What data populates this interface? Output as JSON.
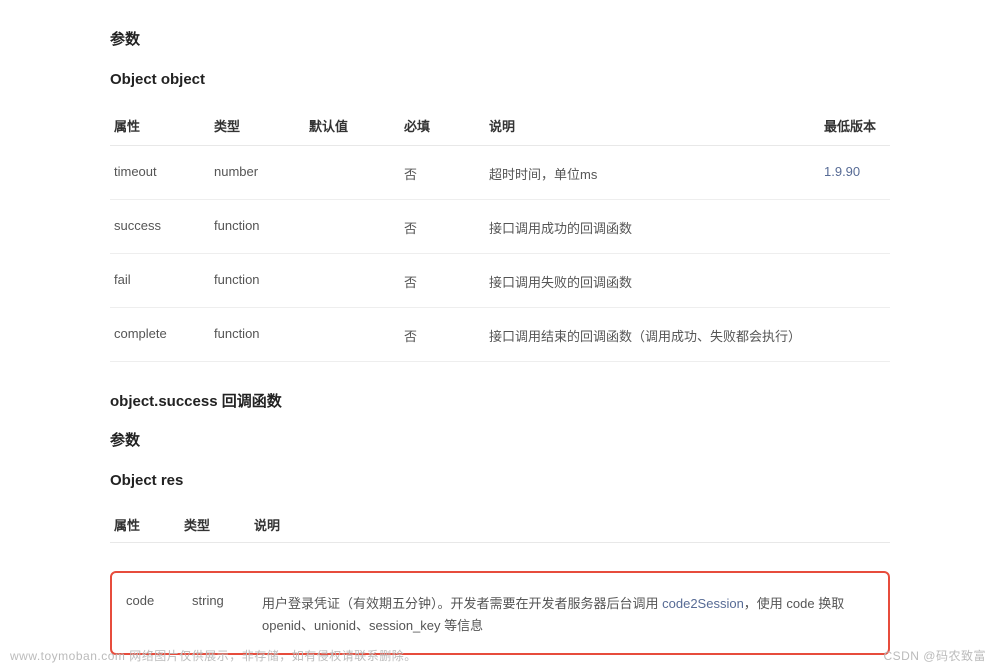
{
  "heading_params": "参数",
  "heading_object": "Object object",
  "table1": {
    "headers": {
      "attr": "属性",
      "type": "类型",
      "default": "默认值",
      "required": "必填",
      "desc": "说明",
      "minver": "最低版本"
    },
    "rows": [
      {
        "attr": "timeout",
        "type": "number",
        "default": "",
        "required": "否",
        "desc": "超时时间，单位ms",
        "minver": "1.9.90",
        "minver_link": true
      },
      {
        "attr": "success",
        "type": "function",
        "default": "",
        "required": "否",
        "desc": "接口调用成功的回调函数",
        "minver": ""
      },
      {
        "attr": "fail",
        "type": "function",
        "default": "",
        "required": "否",
        "desc": "接口调用失败的回调函数",
        "minver": ""
      },
      {
        "attr": "complete",
        "type": "function",
        "default": "",
        "required": "否",
        "desc": "接口调用结束的回调函数（调用成功、失败都会执行）",
        "minver": ""
      }
    ]
  },
  "heading_callback": "object.success 回调函数",
  "heading_params2": "参数",
  "heading_res": "Object res",
  "table2": {
    "headers": {
      "attr": "属性",
      "type": "类型",
      "desc": "说明"
    },
    "row": {
      "attr": "code",
      "type": "string",
      "desc_prefix": "用户登录凭证（有效期五分钟）。开发者需要在开发者服务器后台调用 ",
      "desc_link": "code2Session",
      "desc_suffix": "，使用 code 换取 openid、unionid、session_key 等信息"
    }
  },
  "watermark_left": "www.toymoban.com 网络图片仅供展示，非存储，如有侵权请联系删除。",
  "watermark_right": "CSDN @码农致富"
}
